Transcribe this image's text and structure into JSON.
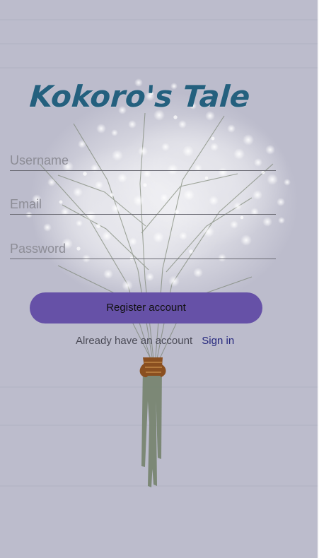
{
  "app": {
    "title": "Kokoro's Tale"
  },
  "form": {
    "username_placeholder": "Username",
    "email_placeholder": "Email",
    "password_placeholder": "Password",
    "register_label": "Register account"
  },
  "footer": {
    "prompt": "Already have an account",
    "signin_label": "Sign in"
  },
  "colors": {
    "background": "#bcbccc",
    "title": "#24607e",
    "accent": "#6651a7",
    "link": "#26287e"
  },
  "icons": {
    "background_art": "bouquet-illustration"
  }
}
